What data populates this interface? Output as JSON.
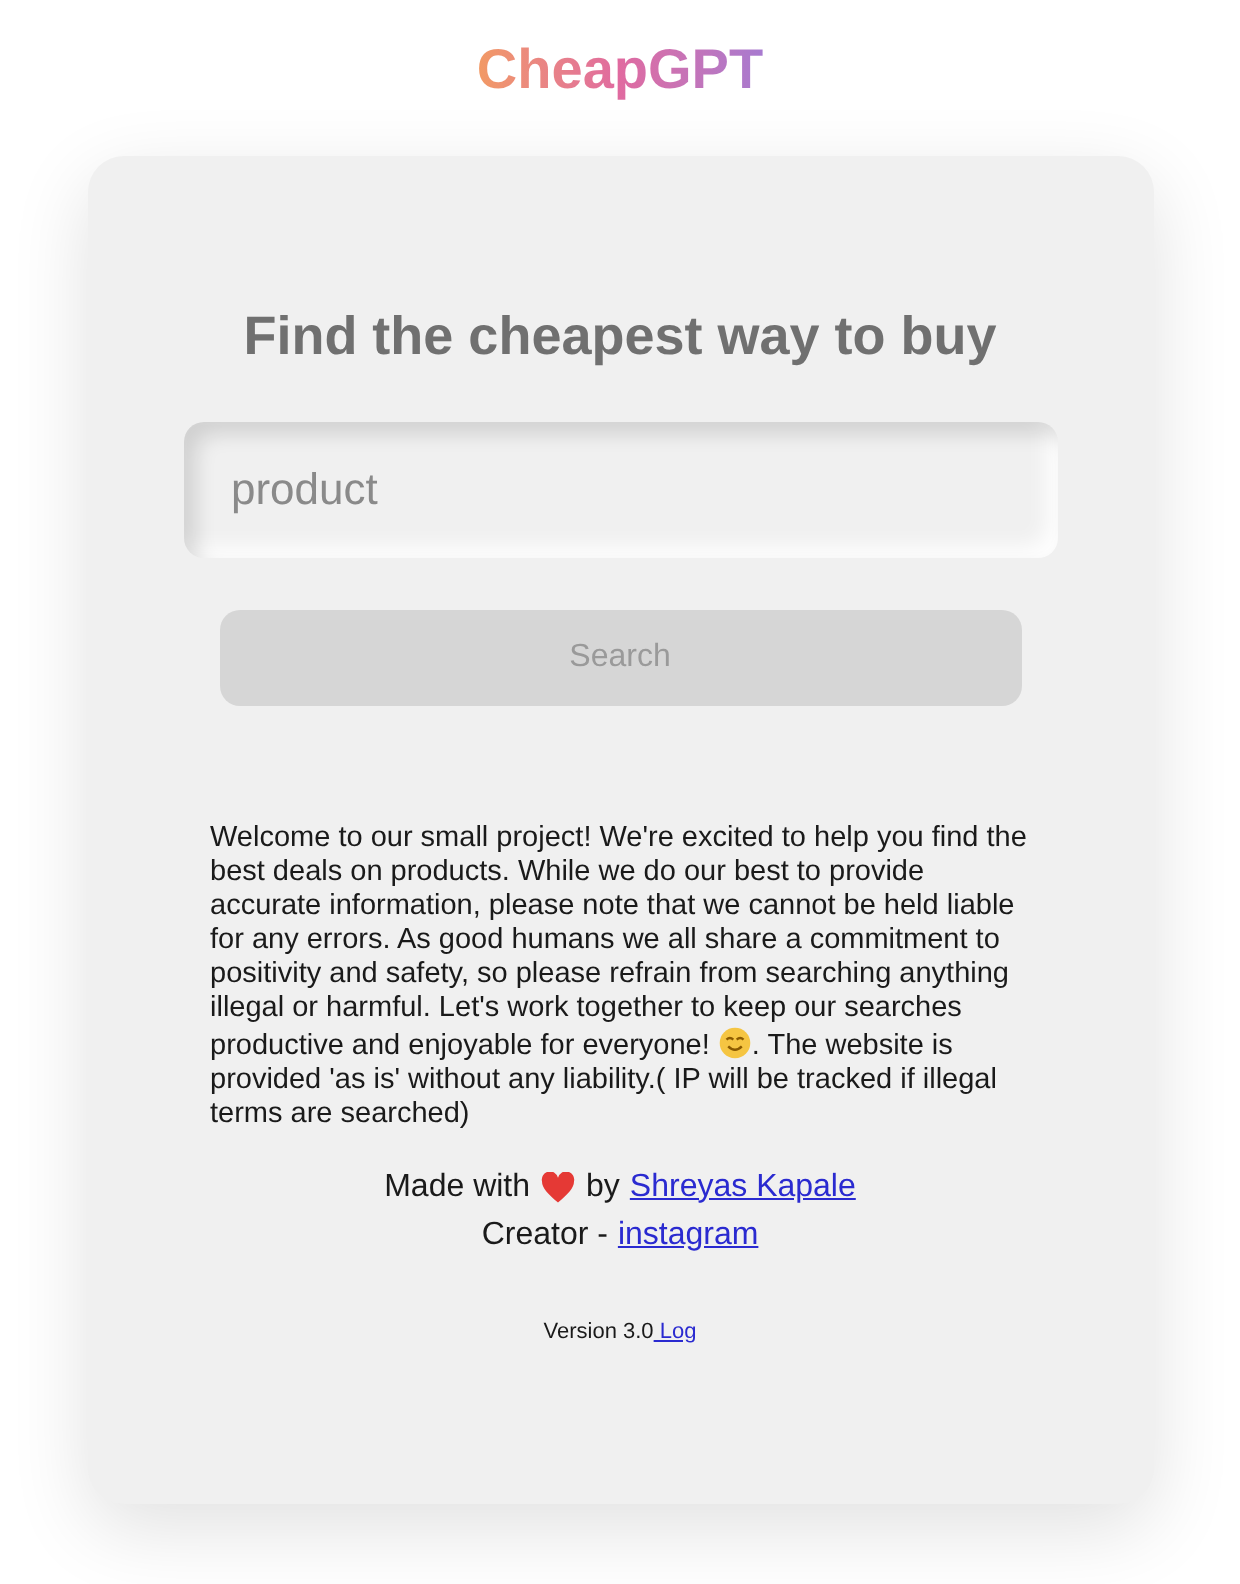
{
  "logo": "CheapGPT",
  "heading": "Find the cheapest way to buy",
  "search": {
    "placeholder": "product"
  },
  "button": "Search",
  "notice": {
    "before_icon": "Welcome to our small project! We're excited to help you find the best deals on products. While we do our best to provide accurate information, please note that we cannot be held liable for any errors. As good humans we all share a commitment to positivity and safety, so please refrain from searching anything illegal or harmful. Let's work together to keep our searches productive and enjoyable for everyone!",
    "after_icon": ". The website is provided 'as is' without any liability.( IP will be tracked if illegal terms are searched)"
  },
  "credit": {
    "before_icon": "Made with",
    "after_icon": "by",
    "link": "Shreyas Kapale"
  },
  "creator": {
    "label": "Creator -",
    "link": "instagram"
  },
  "version": {
    "label": "Version 3.0",
    "link": " Log"
  }
}
